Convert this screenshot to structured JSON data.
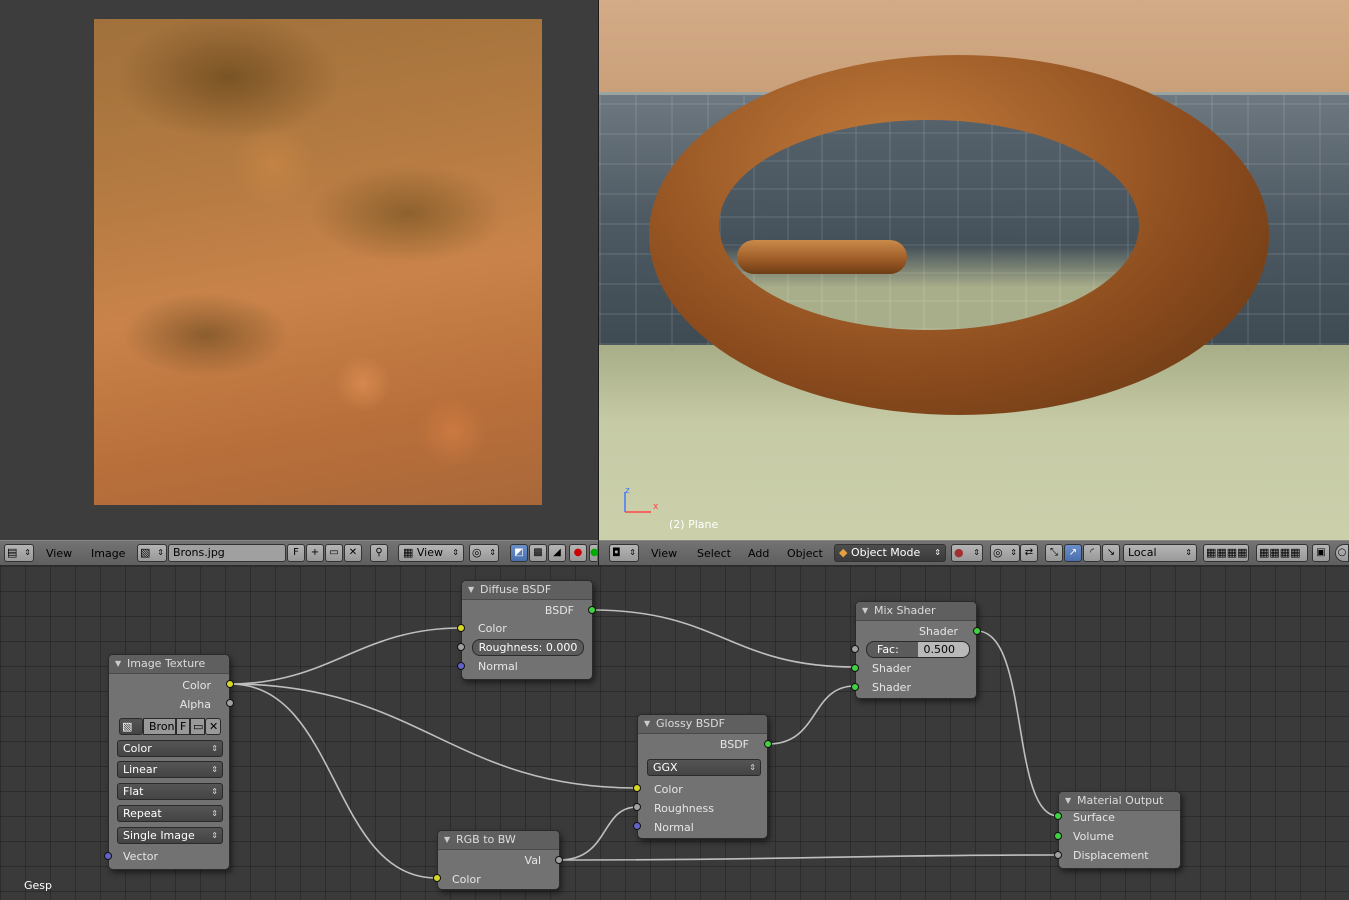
{
  "image_editor": {
    "menus": [
      "View",
      "Image"
    ],
    "image_name": "Brons.jpg",
    "fake_user_label": "F",
    "view_select": "View"
  },
  "viewport": {
    "object_label": "(2) Plane",
    "axis_z": "z",
    "axis_x": "x",
    "menus": [
      "View",
      "Select",
      "Add",
      "Object"
    ],
    "mode": "Object Mode",
    "pivot": "Local"
  },
  "nodes": {
    "diffuse": {
      "title": "Diffuse BSDF",
      "output": "BSDF",
      "inputs": [
        "Color",
        "Normal"
      ],
      "roughness_label": "Roughness:",
      "roughness_value": "0.000"
    },
    "mix": {
      "title": "Mix Shader",
      "output": "Shader",
      "fac_label": "Fac:",
      "fac_value": "0.500",
      "inputs": [
        "Shader",
        "Shader"
      ]
    },
    "image_texture": {
      "title": "Image Texture",
      "outputs": [
        "Color",
        "Alpha"
      ],
      "image_short": "Bron",
      "fake_user_label": "F",
      "color_space": "Color",
      "interpolation": "Linear",
      "projection": "Flat",
      "extension": "Repeat",
      "source": "Single Image",
      "input": "Vector"
    },
    "glossy": {
      "title": "Glossy BSDF",
      "output": "BSDF",
      "distribution": "GGX",
      "inputs": [
        "Color",
        "Roughness",
        "Normal"
      ]
    },
    "rgb_bw": {
      "title": "RGB to BW",
      "output": "Val",
      "input": "Color"
    },
    "output": {
      "title": "Material Output",
      "inputs": [
        "Surface",
        "Volume",
        "Displacement"
      ]
    }
  },
  "footer_label": "Gesp",
  "colors": {
    "socket_color": "#d6d62a",
    "socket_shader": "#3fd13f",
    "socket_value": "#a1a1a1",
    "socket_vector": "#6363c7"
  }
}
